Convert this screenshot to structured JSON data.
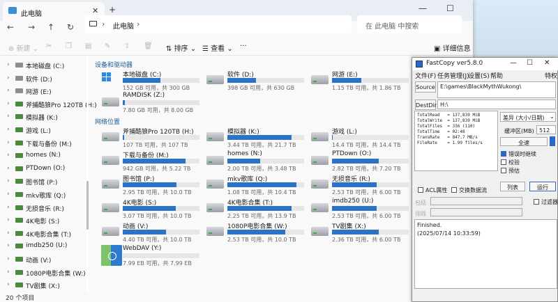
{
  "explorer": {
    "tab_label": "此电脑",
    "tab_close": "✕",
    "new_tab": "+",
    "win_min": "—",
    "win_max": "☐",
    "breadcrumb_sep": "›",
    "breadcrumb": "此电脑",
    "search_placeholder": "在 此电脑 中搜索",
    "toolbar": {
      "new_label": "新建",
      "sort_label": "排序",
      "view_label": "查看",
      "more_label": "···",
      "details_label": "详细信息"
    },
    "sidebar": [
      {
        "label": "本地磁盘 (C:)",
        "green": false
      },
      {
        "label": "软件 (D:)",
        "green": false
      },
      {
        "label": "网游 (E:)",
        "green": false
      },
      {
        "label": "斧捕酷狼Pro 120TB  (H:)",
        "green": true
      },
      {
        "label": "模拟器 (K:)",
        "green": true
      },
      {
        "label": "游戏  (L:)",
        "green": true
      },
      {
        "label": "下载与备份 (M:)",
        "green": true
      },
      {
        "label": "homes (N:)",
        "green": true
      },
      {
        "label": "PTDown  (O:)",
        "green": true
      },
      {
        "label": "图书馆 (P:)",
        "green": true
      },
      {
        "label": "mkv歌库  (Q:)",
        "green": true
      },
      {
        "label": "无损音乐 (R:)",
        "green": true
      },
      {
        "label": "4K电影 (S:)",
        "green": true
      },
      {
        "label": "4K电影合集 (T:)",
        "green": true
      },
      {
        "label": "imdb250 (U:)",
        "green": true
      },
      {
        "label": "动画 (V:)",
        "green": true
      },
      {
        "label": "1080P电影合集 (W:)",
        "green": true
      },
      {
        "label": "TV剧集 (X:)",
        "green": true
      }
    ],
    "section_devices": "设备和驱动器",
    "section_network": "网络位置",
    "devices": [
      {
        "name": "本地磁盘 (C:)",
        "size": "152 GB 可用，共 300 GB",
        "used": 0.49,
        "icon": "windows"
      },
      {
        "name": "软件 (D:)",
        "size": "398 GB 可用，共 630 GB",
        "used": 0.37,
        "icon": "disk"
      },
      {
        "name": "网游 (E:)",
        "size": "1.15 TB 可用，共 1.86 TB",
        "used": 0.38,
        "icon": "disk"
      },
      {
        "name": "RAMDISK (Z:)",
        "size": "7.80 GB 可用，共 8.00 GB",
        "used": 0.03,
        "icon": "disk"
      }
    ],
    "network": [
      {
        "name": "斧捕酷狼Pro 120TB  (H:)",
        "size": "107 TB 可用，共 107 TB",
        "used": 0.02
      },
      {
        "name": "模拟器 (K:)",
        "size": "3.44 TB 可用，共 21.7 TB",
        "used": 0.84
      },
      {
        "name": "游戏  (L:)",
        "size": "14.4 TB 可用，共 14.4 TB",
        "used": 0.01
      },
      {
        "name": "下载与备份 (M:)",
        "size": "942 GB 可用，共 5.22 TB",
        "used": 0.82
      },
      {
        "name": "homes (N:)",
        "size": "2.00 TB 可用，共 3.48 TB",
        "used": 0.43
      },
      {
        "name": "PTDown  (O:)",
        "size": "2.82 TB 可用，共 7.20 TB",
        "used": 0.61
      },
      {
        "name": "图书馆 (P:)",
        "size": "2.95 TB 可用，共 10.0 TB",
        "used": 0.7
      },
      {
        "name": "mkv歌库  (Q:)",
        "size": "1.08 TB 可用，共 10.4 TB",
        "used": 0.9
      },
      {
        "name": "无损音乐 (R:)",
        "size": "2.53 TB 可用，共 6.00 TB",
        "used": 0.58
      },
      {
        "name": "4K电影 (S:)",
        "size": "3.07 TB 可用，共 10.0 TB",
        "used": 0.69
      },
      {
        "name": "4K电影合集 (T:)",
        "size": "2.25 TB 可用，共 13.9 TB",
        "used": 0.84
      },
      {
        "name": "imdb250 (U:)",
        "size": "2.53 TB 可用，共 6.00 TB",
        "used": 0.58
      },
      {
        "name": "动画 (V:)",
        "size": "4.40 TB 可用，共 10.0 TB",
        "used": 0.56
      },
      {
        "name": "1080P电影合集 (W:)",
        "size": "2.53 TB 可用，共 10.0 TB",
        "used": 0.75
      },
      {
        "name": "TV剧集 (X:)",
        "size": "2.36 TB 可用，共 6.00 TB",
        "used": 0.61
      }
    ],
    "webdav": {
      "name": "WebDAV (Y:)",
      "size": "7.99 EB 可用，共 7.99 EB",
      "used": 0.0
    },
    "status": "20 个项目"
  },
  "fastcopy": {
    "title": "FastCopy ver5.8.0",
    "win_min": "—",
    "win_max": "☐",
    "win_close": "✕",
    "menu": [
      "文件(F)",
      "任务管理(J)",
      "设置(S)",
      "帮助"
    ],
    "menu_right": "特权",
    "source_label": "Source",
    "source_value": "E:\\games\\BlackMythWukong\\",
    "destdir_label": "DestDir",
    "destdir_value": "H:\\",
    "stats": "TotalRead   = 137,839 MiB\nTotalWrite  = 137,839 MiB\nTotalFiles  = 336 (110)\nTotalTime   = 02:48\nTransRate   = 847.7 MB/s\nFileRate    = 1.99 files/s",
    "mode": "差异 (大小/日期)",
    "buffer_label": "缓冲区(MB)",
    "buffer_value": "512",
    "speed_label": "全速",
    "opt_continue": "错误时继续",
    "opt_verify": "校验",
    "opt_estimate": "预估",
    "acl_label": "ACL属性",
    "stream_label": "交换数据流",
    "list_btn": "列表",
    "run_btn": "运行",
    "include_label": "包括",
    "exclude_label": "排除",
    "filter_label": "过滤器",
    "log_line1": "Finished.",
    "log_line2": "(2025/07/14 10:33:59)"
  }
}
